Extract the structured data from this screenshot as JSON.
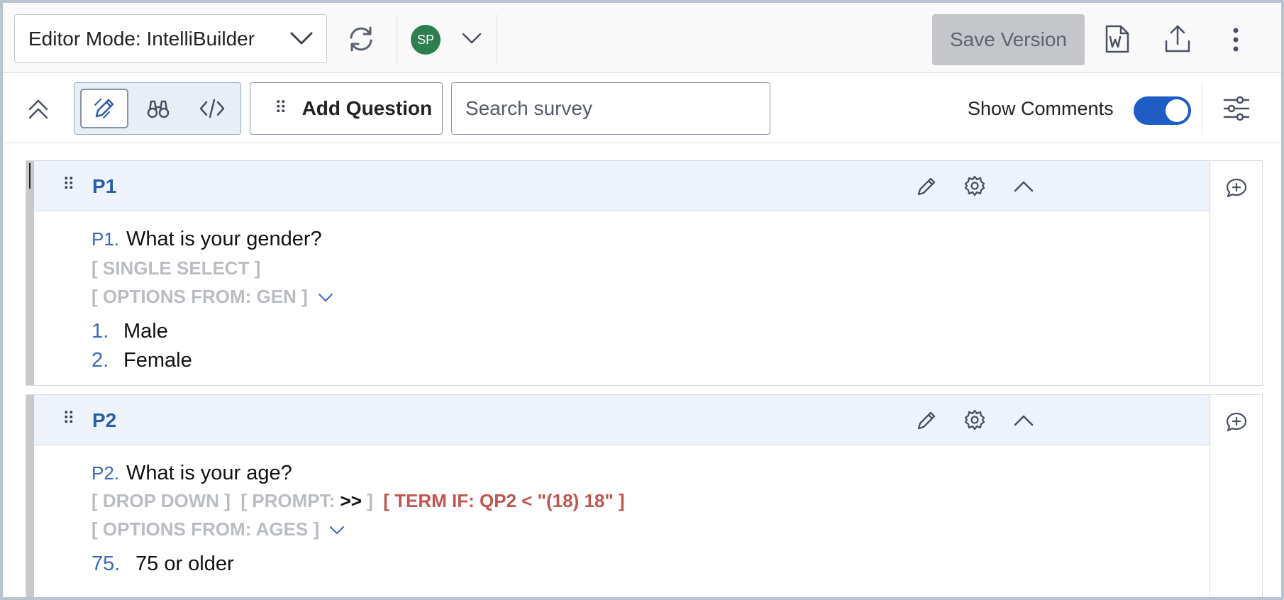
{
  "toolbar_top": {
    "editor_mode_label": "Editor Mode: IntelliBuilder",
    "avatar_initials": "SP",
    "save_version_label": "Save Version"
  },
  "toolbar_second": {
    "add_question_label": "Add Question",
    "search_placeholder": "Search survey",
    "show_comments_label": "Show Comments",
    "show_comments_on": true
  },
  "questions": [
    {
      "id": "P1",
      "number_label": "P1.",
      "text": "What is your gender?",
      "type_tag": "[ SINGLE SELECT ]",
      "options_from": "[ OPTIONS FROM: GEN ]",
      "options": [
        {
          "num": "1.",
          "label": "Male"
        },
        {
          "num": "2.",
          "label": "Female"
        }
      ]
    },
    {
      "id": "P2",
      "number_label": "P2.",
      "text": "What is your age?",
      "type_tag": "[ DROP DOWN ]",
      "prompt_prefix": "[ PROMPT:",
      "prompt_value": ">>",
      "prompt_suffix": "]",
      "term_if": "[ TERM IF: QP2 < \"(18) 18\" ]",
      "options_from": "[ OPTIONS FROM: AGES ]",
      "options": [
        {
          "num": "75.",
          "label": "75 or older"
        }
      ]
    }
  ],
  "colors": {
    "accent": "#1e5dc4",
    "question_id": "#2a5ea8",
    "term_red": "#c0564f",
    "avatar_green": "#2e7d4f"
  }
}
